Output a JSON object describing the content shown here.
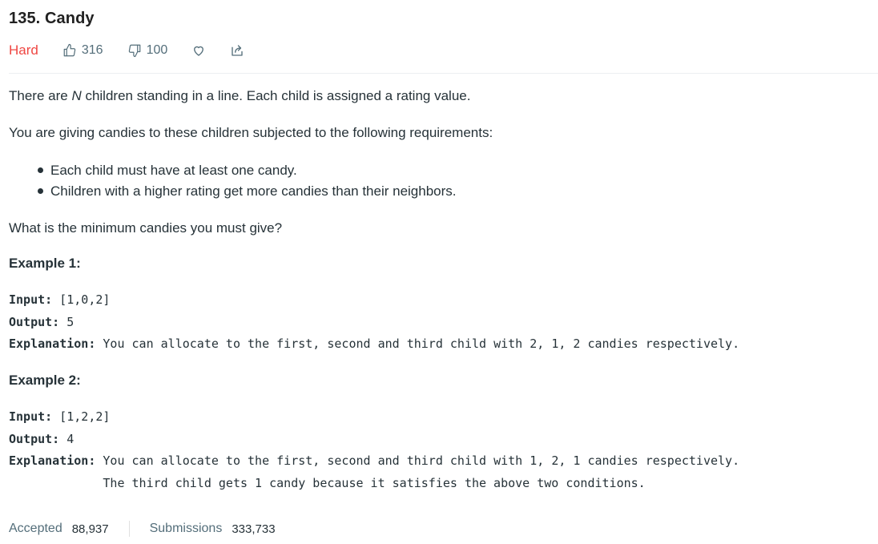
{
  "problem": {
    "title": "135. Candy",
    "difficulty": "Hard",
    "likes": "316",
    "dislikes": "100"
  },
  "description": {
    "p1_before": "There are ",
    "p1_var": "N",
    "p1_after": " children standing in a line. Each child is assigned a rating value.",
    "p2": "You are giving candies to these children subjected to the following requirements:",
    "bullets": [
      "Each child must have at least one candy.",
      "Children with a higher rating get more candies than their neighbors."
    ],
    "p3": "What is the minimum candies you must give?"
  },
  "examples": [
    {
      "title": "Example 1:",
      "input_label": "Input:",
      "input_value": " [1,0,2]",
      "output_label": "Output:",
      "output_value": " 5",
      "explanation_label": "Explanation:",
      "explanation_value": " You can allocate to the first, second and third child with 2, 1, 2 candies respectively."
    },
    {
      "title": "Example 2:",
      "input_label": "Input:",
      "input_value": " [1,2,2]",
      "output_label": "Output:",
      "output_value": " 4",
      "explanation_label": "Explanation:",
      "explanation_value": " You can allocate to the first, second and third child with 1, 2, 1 candies respectively.",
      "explanation_value_2": "             The third child gets 1 candy because it satisfies the above two conditions."
    }
  ],
  "stats": {
    "accepted_label": "Accepted",
    "accepted_value": "88,937",
    "submissions_label": "Submissions",
    "submissions_value": "333,733"
  },
  "icons": {
    "like": "thumbs-up-icon",
    "dislike": "thumbs-down-icon",
    "favorite": "heart-icon",
    "share": "share-icon"
  },
  "colors": {
    "difficulty_hard": "#ef4743",
    "text": "#263238",
    "muted": "#546e7a"
  }
}
